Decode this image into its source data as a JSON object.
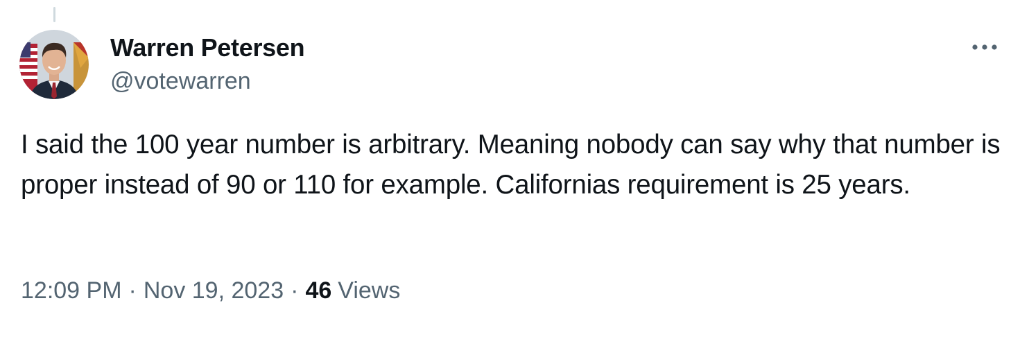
{
  "tweet": {
    "author_name": "Warren Petersen",
    "author_handle": "@votewarren",
    "text": "I said the 100 year number is arbitrary. Meaning nobody can say why that number is proper instead of 90 or 110 for example. Californias requirement is 25 years.",
    "time": "12:09 PM",
    "date": "Nov 19, 2023",
    "separator": "·",
    "views_count": "46",
    "views_label": "Views"
  },
  "icons": {
    "more": "more-horizontal-icon",
    "avatar": "profile-photo"
  },
  "colors": {
    "primary_text": "#0f1419",
    "secondary_text": "#536471",
    "thread_line": "#cfd9de",
    "background": "#ffffff"
  }
}
